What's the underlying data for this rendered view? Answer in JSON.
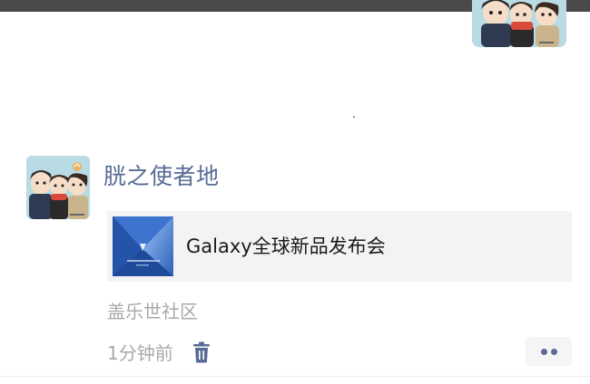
{
  "feed": {
    "post": {
      "author_name": "胱之使者地",
      "link_card": {
        "thumbnail_icon": "galaxy-event-thumbnail",
        "title": "Galaxy全球新品发布会"
      },
      "source_name": "盖乐世社区",
      "timestamp": "1分钟前",
      "delete_icon": "trash-icon",
      "more_icon": "more-dots-icon"
    }
  },
  "colors": {
    "name_link": "#576b95",
    "meta_text": "#a9a9a9",
    "card_background": "#f3f3f5",
    "top_bar": "#4a4a4a"
  }
}
